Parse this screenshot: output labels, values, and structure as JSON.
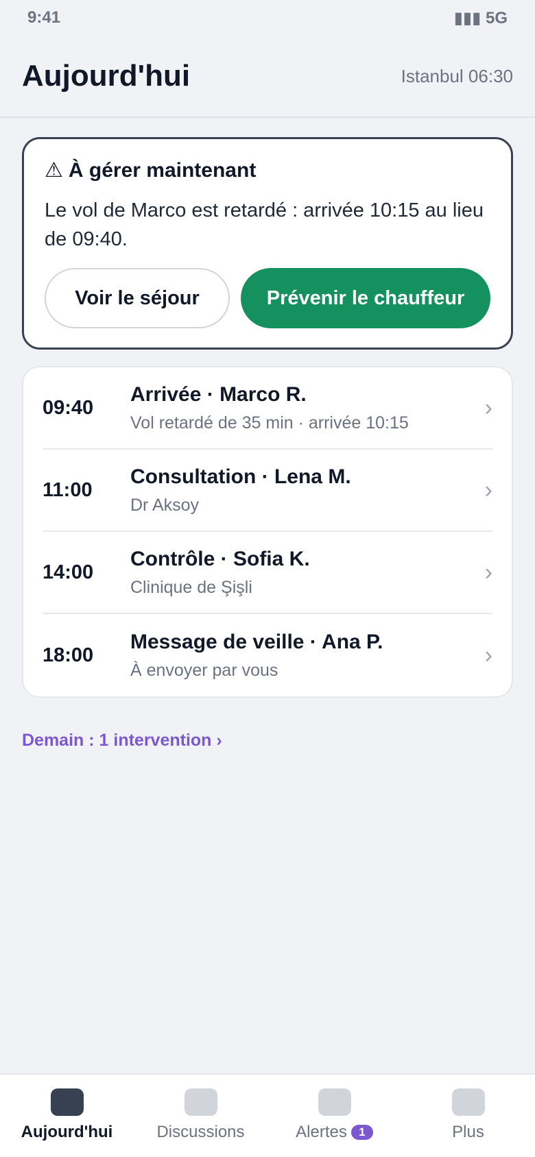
{
  "status_bar": {
    "time": "9:41",
    "signal": "▮▮▮ 5G"
  },
  "header": {
    "title": "Aujourd'hui",
    "location_time": "Istanbul 06:30"
  },
  "alert": {
    "icon": "⚠",
    "title": "À gérer maintenant",
    "body": "Le vol de Marco est retardé : arrivée 10:15 au lieu de 09:40.",
    "secondary_label": "Voir le séjour",
    "primary_label": "Prévenir le chauffeur"
  },
  "schedule": [
    {
      "time": "09:40",
      "title": "Arrivée · Marco R.",
      "subtitle": "Vol retardé de 35 min · arrivée 10:15"
    },
    {
      "time": "11:00",
      "title": "Consultation · Lena M.",
      "subtitle": "Dr Aksoy"
    },
    {
      "time": "14:00",
      "title": "Contrôle · Sofia K.",
      "subtitle": "Clinique de Şişli"
    },
    {
      "time": "18:00",
      "title": "Message de veille · Ana P.",
      "subtitle": "À envoyer par vous"
    }
  ],
  "chevron": "›",
  "tomorrow_link": "Demain : 1 intervention ›",
  "tabs": [
    {
      "label": "Aujourd'hui"
    },
    {
      "label": "Discussions"
    },
    {
      "label": "Alertes",
      "badge": "1"
    },
    {
      "label": "Plus"
    }
  ],
  "colors": {
    "primary": "#15905f",
    "accent": "#7c58d0",
    "active_tab": "#374151"
  }
}
